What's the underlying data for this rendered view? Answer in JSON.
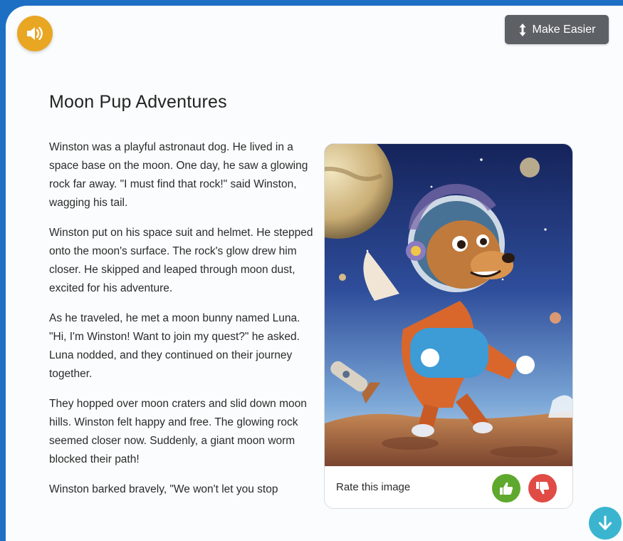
{
  "toolbar": {
    "audio_icon": "speaker-icon",
    "make_easier_label": "Make Easier",
    "make_easier_icon": "vertical-arrows-icon"
  },
  "story": {
    "title": "Moon  Pup Adventures",
    "paragraphs": [
      "Winston was a playful astronaut dog.  He lived in a space base on the moon. One day, he saw a glowing rock far away. \"I must find that rock!\" said Winston, wagging his tail.",
      "Winston put on his space suit and helmet.  He stepped onto the moon's surface. The rock's glow drew him closer.  He skipped and leaped through moon dust, excited for his adventure.",
      "As he traveled, he met a moon bunny named Luna. \"Hi,  I'm Winston! Want to join my quest?\" he asked.  Luna nodded, and they continued on their journey together.",
      "They hopped over moon craters and slid down moon hills. Winston felt happy and free. The glowing rock seemed closer now. Suddenly, a giant moon worm blocked their path!",
      "Winston barked bravely, \"We won't let you stop"
    ]
  },
  "image_card": {
    "rate_label": "Rate this image",
    "thumbs_up_icon": "thumbs-up-icon",
    "thumbs_down_icon": "thumbs-down-icon"
  },
  "navigation": {
    "scroll_down_icon": "arrow-down-icon"
  },
  "colors": {
    "frame_border": "#1d6fc4",
    "audio_button": "#e9a623",
    "make_easier_button": "#5d6166",
    "thumbs_up": "#5fa82e",
    "thumbs_down": "#e04c45",
    "scroll_down": "#3bb5cf"
  }
}
